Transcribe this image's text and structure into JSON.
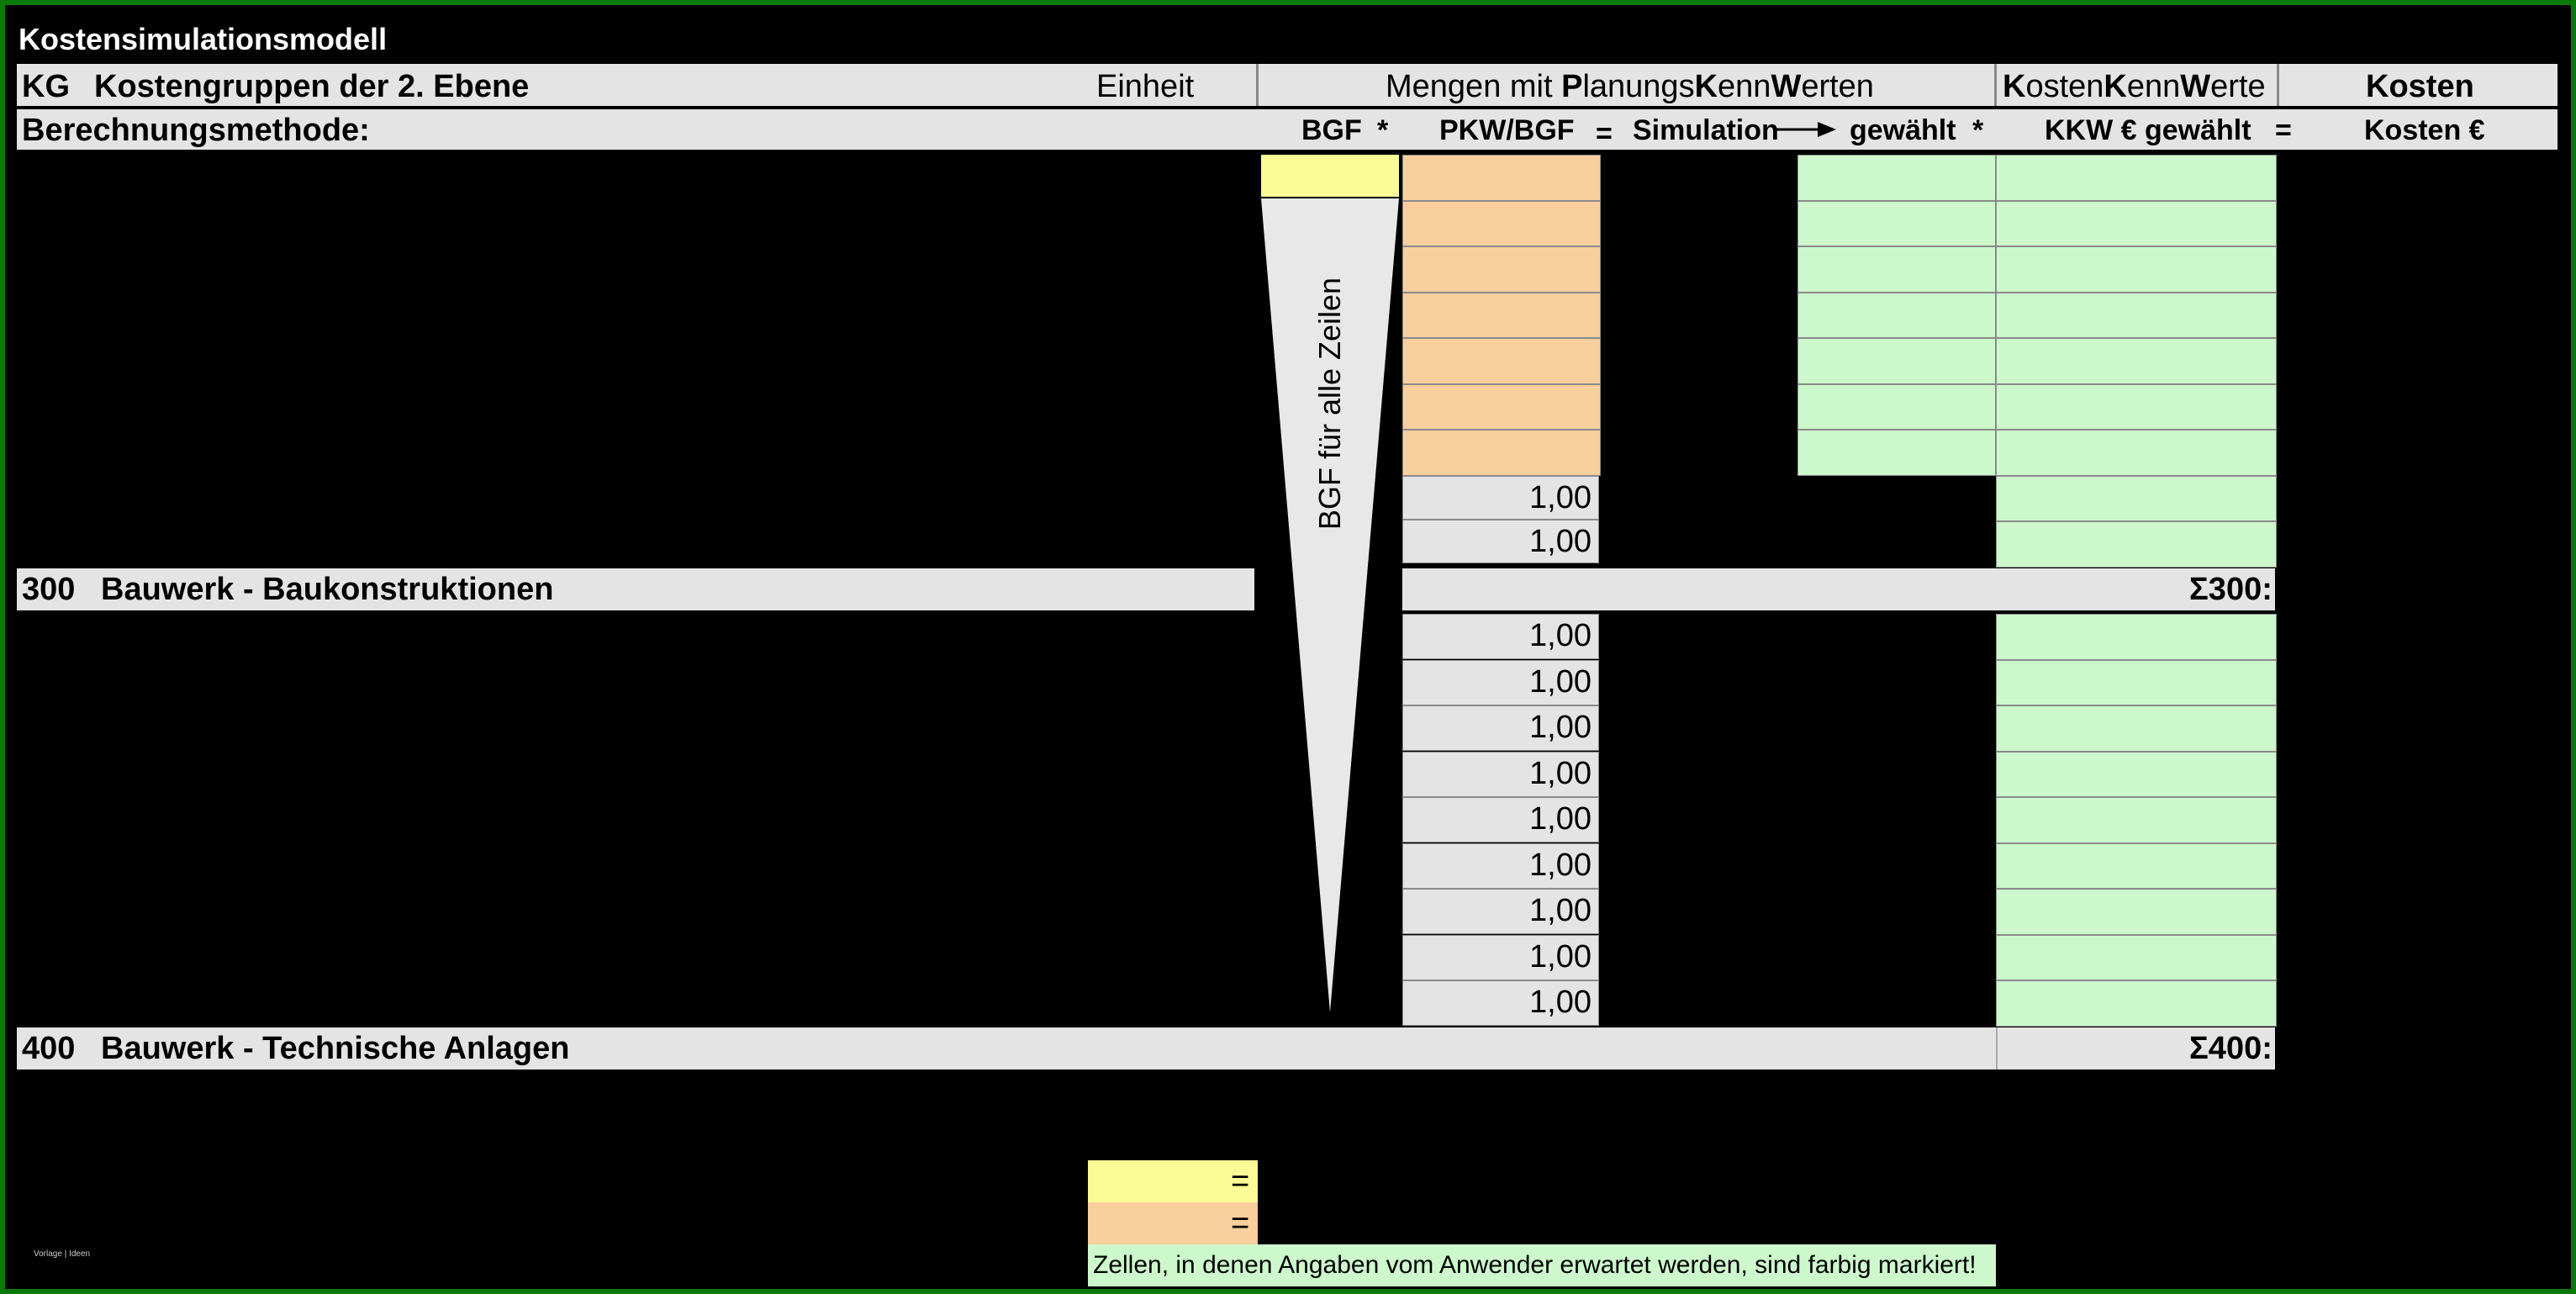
{
  "title": "Kostensimulationsmodell",
  "header": {
    "kg": "KG",
    "kostengruppen": "Kostengruppen der 2. Ebene",
    "einheit": "Einheit",
    "mengen_parts": [
      "Mengen mit ",
      "P",
      "lanungs",
      "K",
      "enn",
      "W",
      "erten"
    ],
    "kkw_parts": [
      "K",
      "osten",
      "K",
      "enn",
      "W",
      "erte"
    ],
    "kosten": "Kosten"
  },
  "method_row": {
    "label": "Berechnungsmethode:",
    "bgf": "BGF",
    "times1": "*",
    "pkw_bgf": "PKW/BGF",
    "equals1": "=",
    "simulation": "Simulation",
    "gewaehlt": "gewählt",
    "times2": "*",
    "kkw_gewaehlt": "KKW € gewählt",
    "equals2": "=",
    "kosten_eur": "Kosten €"
  },
  "bgf_note": "BGF für alle Zeilen",
  "group_300": {
    "code": "300",
    "label": "Bauwerk - Baukonstruktionen",
    "sum": "Σ300:"
  },
  "group_400": {
    "code": "400",
    "label": "Bauwerk - Technische Anlagen",
    "sum": "Σ400:"
  },
  "values_upper": [
    "1,00",
    "1,00"
  ],
  "values_lower": [
    "1,00",
    "1,00",
    "1,00",
    "1,00",
    "1,00",
    "1,00",
    "1,00",
    "1,00",
    "1,00"
  ],
  "legend": {
    "yellow_eq": "=",
    "orange_eq": "=",
    "note": "Zellen, in denen Angaben vom Anwender erwartet werden, sind farbig markiert!"
  },
  "footer_small": "Vorlage | Ideen",
  "colors": {
    "frame": "#0a7a0a",
    "grey": "#e4e4e4",
    "yellow": "#fafa96",
    "orange": "#f9cf9d",
    "green": "#ccf8cc"
  }
}
